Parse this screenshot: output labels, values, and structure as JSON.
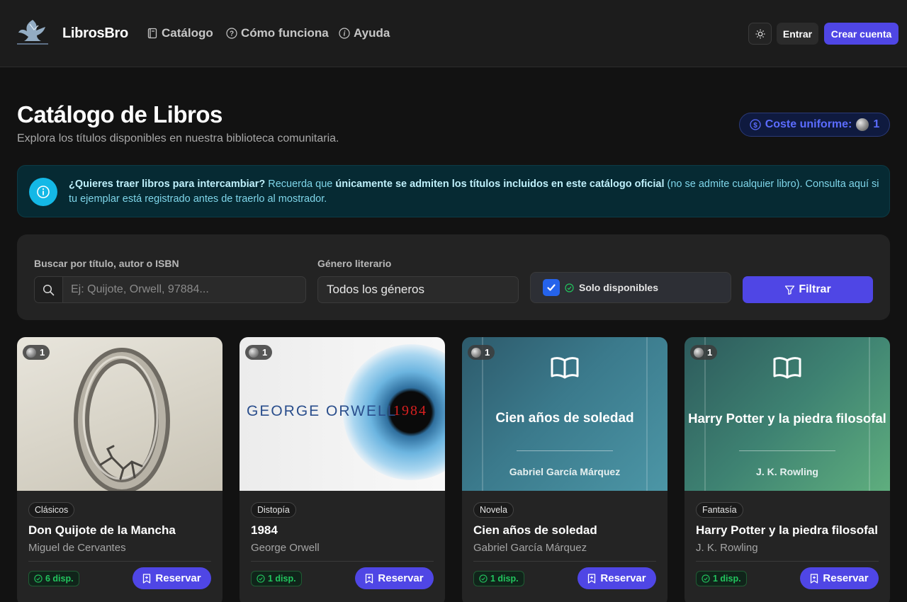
{
  "header": {
    "brand": "LibrosBro",
    "nav": [
      {
        "label": "Catálogo",
        "icon": "book-icon"
      },
      {
        "label": "Cómo funciona",
        "icon": "help-circle-icon"
      },
      {
        "label": "Ayuda",
        "icon": "info-circle-icon"
      }
    ],
    "theme_icon": "sun-icon",
    "login_label": "Entrar",
    "register_label": "Crear cuenta"
  },
  "page": {
    "title": "Catálogo de Libros",
    "subtitle": "Explora los títulos disponibles en nuestra biblioteca comunitaria.",
    "cost_label": "Coste uniforme:",
    "cost_value": "1"
  },
  "info": {
    "strong1": "¿Quieres traer libros para intercambiar?",
    "text1": " Recuerda que ",
    "strong2": "únicamente se admiten los títulos incluidos en este catálogo oficial",
    "text2": " (no se admite cualquier libro). Consulta aquí si tu ejemplar está registrado antes de traerlo al mostrador."
  },
  "filters": {
    "search_label": "Buscar por título, autor o ISBN",
    "search_placeholder": "Ej: Quijote, Orwell, 97884...",
    "search_value": "",
    "genre_label": "Género literario",
    "genre_value": "Todos los géneros",
    "available_label": "Solo disponibles",
    "available_checked": true,
    "filter_button": "Filtrar"
  },
  "books": [
    {
      "cost": "1",
      "genre": "Clásicos",
      "title": "Don Quijote de la Mancha",
      "author": "Miguel de Cervantes",
      "available": "6 disp.",
      "reserve": "Reservar"
    },
    {
      "cost": "1",
      "genre": "Distopía",
      "title": "1984",
      "author": "George Orwell",
      "available": "1 disp.",
      "reserve": "Reservar",
      "cover_text": "GEORGE ORWELL",
      "cover_number": "1984"
    },
    {
      "cost": "1",
      "genre": "Novela",
      "title": "Cien años de soledad",
      "author": "Gabriel García Márquez",
      "available": "1 disp.",
      "reserve": "Reservar",
      "cover_title": "Cien años de soledad",
      "cover_author": "Gabriel García Márquez"
    },
    {
      "cost": "1",
      "genre": "Fantasía",
      "title": "Harry Potter y la piedra filosofal",
      "author": "J. K. Rowling",
      "available": "1 disp.",
      "reserve": "Reservar",
      "cover_title": "Harry Potter y la piedra filosofal",
      "cover_author": "J. K. Rowling"
    }
  ],
  "colors": {
    "accent": "#4f46e5",
    "info_bg": "#062a33",
    "available_green": "#22c55e"
  }
}
